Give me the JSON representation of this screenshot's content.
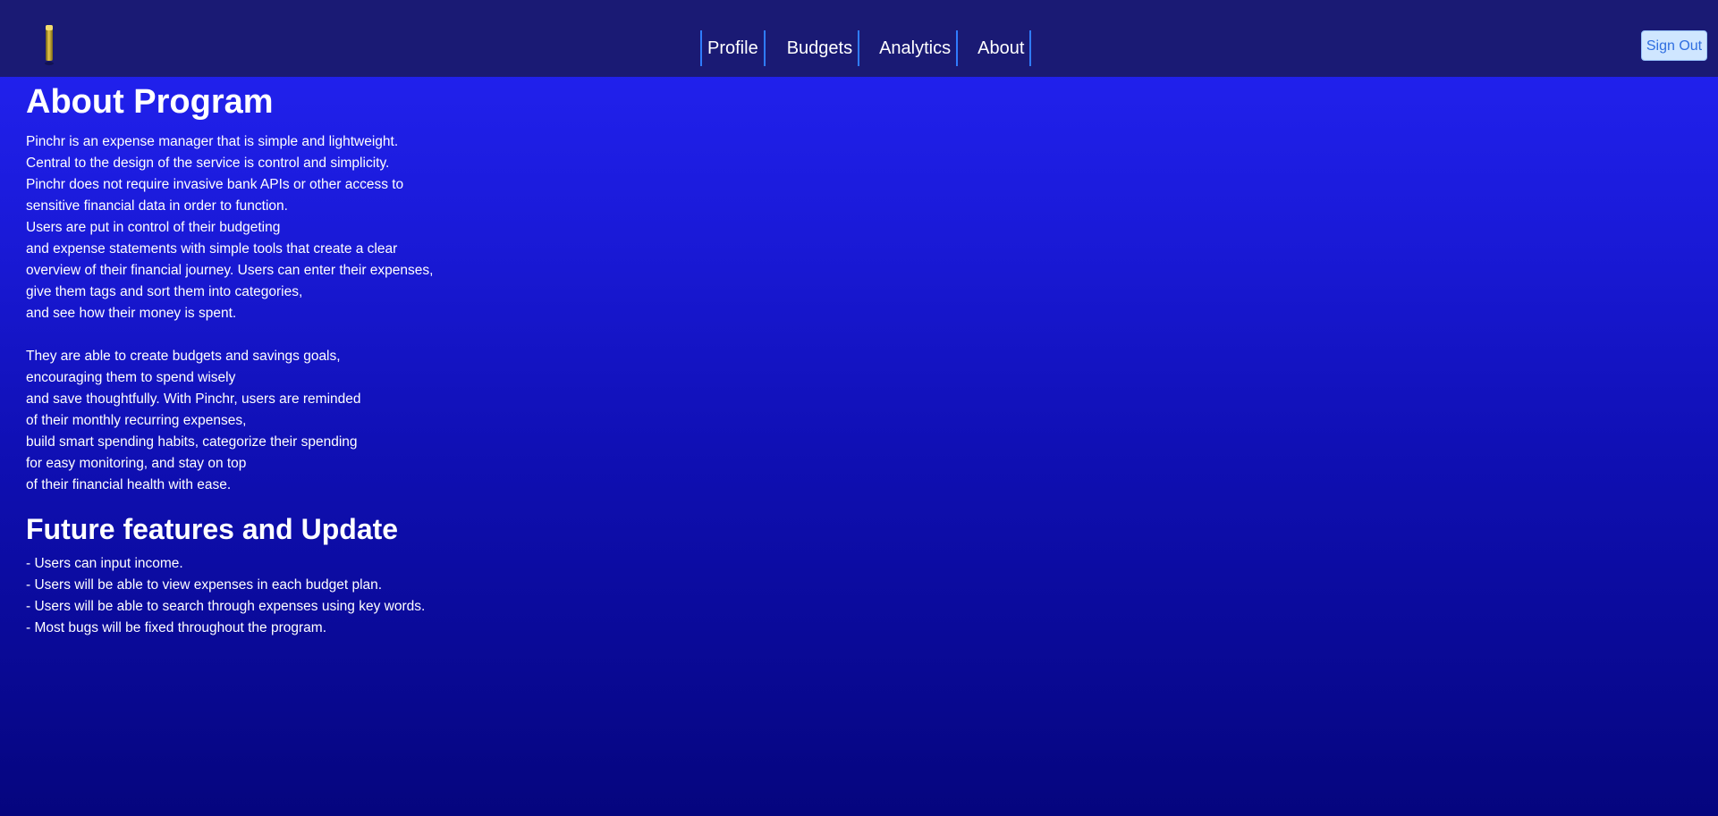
{
  "nav": {
    "items": [
      "Profile",
      "Budgets",
      "Analytics",
      "About"
    ],
    "signout_label": "Sign Out"
  },
  "about": {
    "title": "About Program",
    "paragraph1": [
      "Pinchr is an expense manager that is simple and lightweight.",
      "Central to the design of the service is control and simplicity.",
      "Pinchr does not require invasive bank APIs or other access to",
      "sensitive financial data in order to function.",
      "Users are put in control of their budgeting",
      "and expense statements with simple tools that create a clear",
      "overview of their financial journey. Users can enter their expenses,",
      "give them tags and sort them into categories,",
      "and see how their money is spent."
    ],
    "paragraph2": [
      "They are able to create budgets and savings goals,",
      "encouraging them to spend wisely",
      "and save thoughtfully. With Pinchr, users are reminded",
      "of their monthly recurring expenses,",
      "build smart spending habits, categorize their spending",
      "for easy monitoring, and stay on top",
      "of their financial health with ease."
    ]
  },
  "future": {
    "title": "Future features and Update",
    "items": [
      "- Users can input income.",
      "- Users will be able to view expenses in each budget plan.",
      "- Users will be able to search through expenses using key words.",
      "- Most bugs will be fixed throughout the program."
    ]
  },
  "colors": {
    "navbar_bg": "#1a1a74",
    "nav_separator": "#2f7cff",
    "signout_bg": "#cfe6ff",
    "signout_text": "#2f6ee0",
    "page_gradient_top": "#2424f6",
    "page_gradient_bottom": "#05057e"
  },
  "icons": {
    "logo": "coin-logo-icon"
  }
}
